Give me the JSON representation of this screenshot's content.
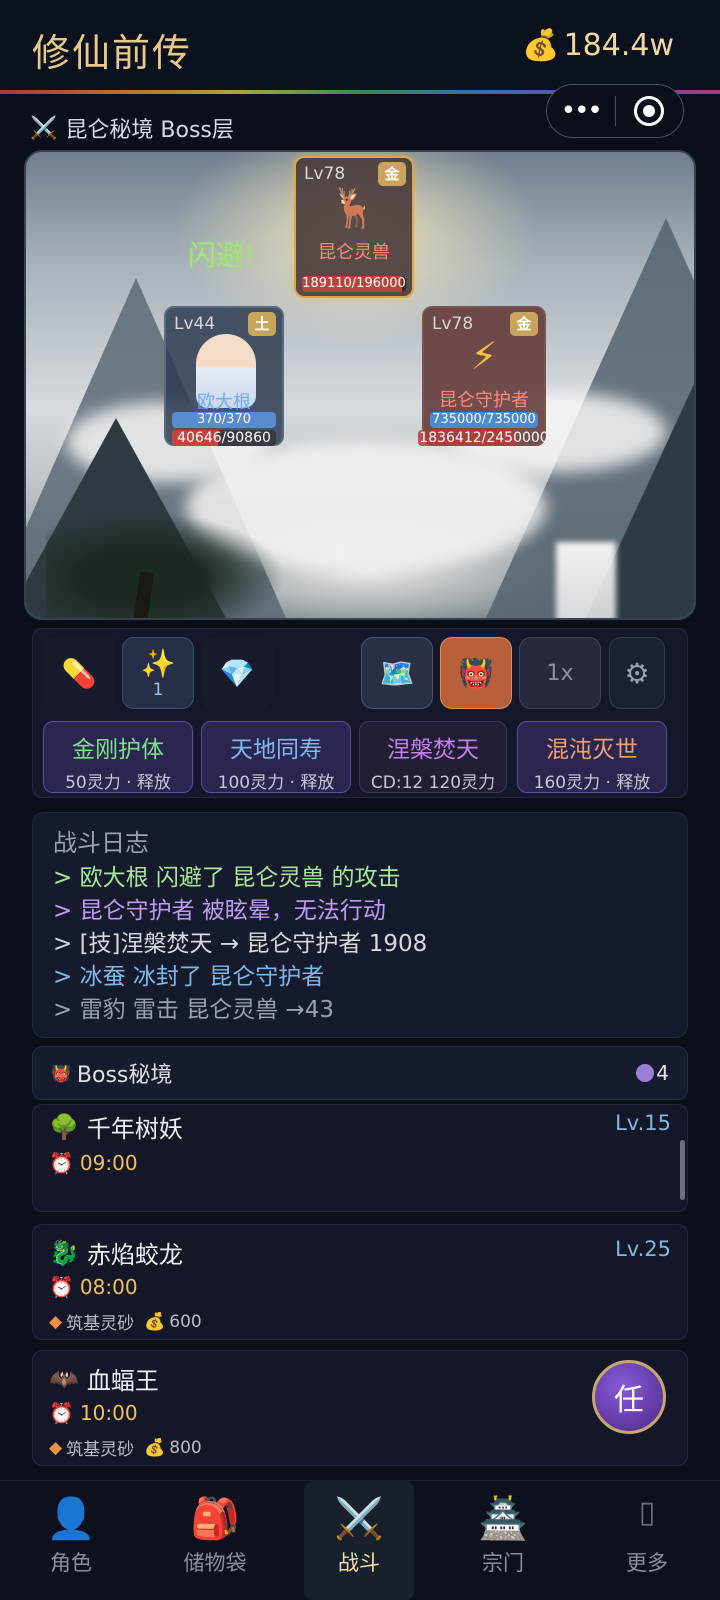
{
  "app": {
    "title": "修仙前传",
    "currency_icon": "money-bag-icon",
    "currency": "184.4w"
  },
  "capsule": {
    "more": "•••"
  },
  "area": {
    "icon": "crossed-swords-icon",
    "title": "昆仑秘境 Boss层"
  },
  "battle": {
    "dodge_text": "闪避!",
    "boss": {
      "level": "Lv78",
      "element": "金",
      "icon": "deer-icon",
      "name": "昆仑灵兽",
      "hp": "189110/196000",
      "hp_fraction": 0.965,
      "hp_color": "#b8443c"
    },
    "guard": {
      "level": "Lv78",
      "element": "金",
      "icon": "lightning-icon",
      "name": "昆仑守护者",
      "shield": "735000/735000",
      "shield_fraction": 1.0,
      "hp": "1836412/2450000",
      "hp_fraction": 0.75
    },
    "hero": {
      "level": "Lv44",
      "element": "土",
      "name": "欧大根",
      "mp": "370/370",
      "mp_fraction": 1.0,
      "hp": "40646/90860",
      "hp_fraction": 0.447
    }
  },
  "controls": {
    "items": [
      {
        "icon": "pill-icon",
        "count": ""
      },
      {
        "icon": "sparkles-icon",
        "count": "1"
      },
      {
        "icon": "diamond-icon",
        "count": ""
      }
    ],
    "map_icon": "map-icon",
    "boss_icon": "demon-icon",
    "speed": "1x",
    "settings_icon": "gear-icon"
  },
  "skills": [
    {
      "name": "金刚护体",
      "cost": "50灵力 · 释放",
      "color": "#7fe08a"
    },
    {
      "name": "天地同寿",
      "cost": "100灵力 · 释放",
      "color": "#7fb8f0"
    },
    {
      "name": "涅槃焚天",
      "cost": "CD:12  120灵力",
      "color": "#c080f0"
    },
    {
      "name": "混沌灭世",
      "cost": "160灵力 · 释放",
      "color": "#f0a070"
    }
  ],
  "log": {
    "title": "战斗日志",
    "lines": [
      {
        "text": "> 欧大根 闪避了 昆仑灵兽 的攻击",
        "color": "#a8e89a"
      },
      {
        "text": "> 昆仑守护者 被眩晕，无法行动",
        "color": "#c09af0"
      },
      {
        "text": "> [技]涅槃焚天 → 昆仑守护者 1908",
        "color": "#d8d8e0"
      },
      {
        "text": "> 冰蚕 冰封了 昆仑守护者",
        "color": "#7fb8e8"
      },
      {
        "text": "> 雷豹 雷击 昆仑灵兽 →43",
        "color": "#9aa0b0"
      }
    ]
  },
  "boss_list": {
    "icon": "demon-icon",
    "title": "Boss秘境",
    "count": "4",
    "entries": [
      {
        "icon": "tree-icon",
        "name": "千年树妖",
        "level": "Lv.15",
        "time": "09:00",
        "reward_item": "",
        "reward_money": ""
      },
      {
        "icon": "dragon-icon",
        "name": "赤焰蛟龙",
        "level": "Lv.25",
        "time": "08:00",
        "reward_item": "筑基灵砂",
        "reward_money": "600"
      },
      {
        "icon": "bat-icon",
        "name": "血蝠王",
        "level": "",
        "time": "10:00",
        "reward_item": "筑基灵砂",
        "reward_money": "800"
      }
    ]
  },
  "fab": {
    "label": "任"
  },
  "tabs": [
    {
      "icon": "person-icon",
      "label": "角色"
    },
    {
      "icon": "backpack-icon",
      "label": "储物袋"
    },
    {
      "icon": "crossed-swords-icon",
      "label": "战斗"
    },
    {
      "icon": "temple-icon",
      "label": "宗门"
    },
    {
      "icon": "more-icon",
      "label": "更多"
    }
  ]
}
